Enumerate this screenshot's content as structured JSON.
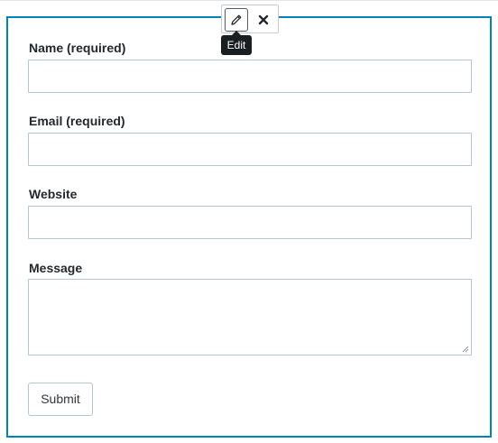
{
  "toolbar": {
    "edit_icon": "pencil-icon",
    "remove_icon": "close-icon",
    "tooltip": "Edit"
  },
  "form": {
    "name_label": "Name (required)",
    "email_label": "Email (required)",
    "website_label": "Website",
    "message_label": "Message",
    "submit_label": "Submit"
  },
  "colors": {
    "selection_border": "#0085ba",
    "field_border": "#b4c7d0",
    "tooltip_bg": "#191e23",
    "text": "#23282d"
  }
}
